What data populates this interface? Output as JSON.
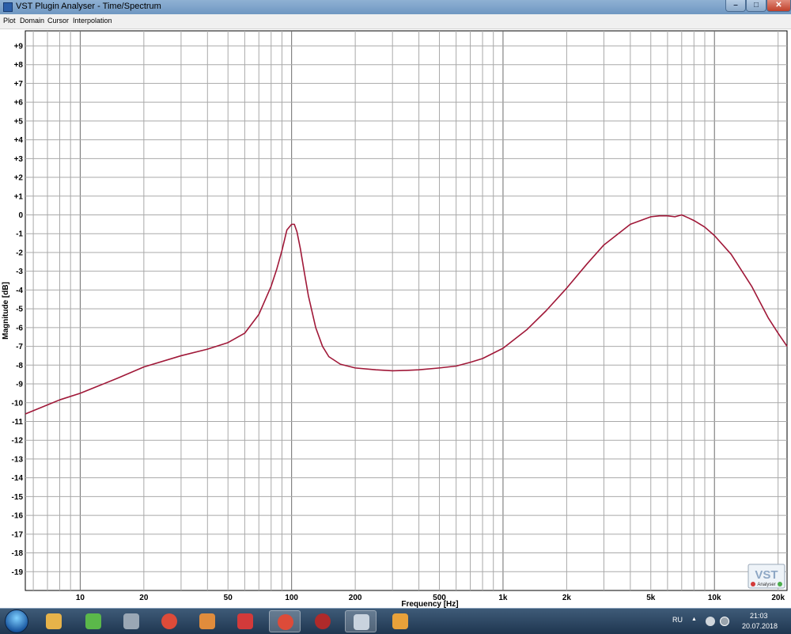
{
  "window": {
    "title": "VST Plugin Analyser - Time/Spectrum",
    "min_glyph": "–",
    "max_glyph": "□",
    "close_glyph": "✕"
  },
  "menu": [
    "Plot",
    "Domain",
    "Cursor",
    "Interpolation"
  ],
  "logo": {
    "text": "VST",
    "subtext": "Analyser"
  },
  "taskbar": {
    "language": "RU",
    "time": "21:03",
    "date": "20.07.2018",
    "tray_arrow": "▲",
    "apps": [
      {
        "name": "start-button",
        "icon": "windows-logo-icon"
      },
      {
        "name": "explorer",
        "icon": "folder-icon",
        "color": "#e7b34a"
      },
      {
        "name": "utorrent",
        "icon": "utorrent-icon",
        "color": "#5bb84a"
      },
      {
        "name": "calculator",
        "icon": "calculator-icon",
        "color": "#9aa7b5"
      },
      {
        "name": "chrome",
        "icon": "chrome-icon",
        "color": "#dd4b39"
      },
      {
        "name": "paint",
        "icon": "palette-icon",
        "color": "#e08c3c"
      },
      {
        "name": "daw",
        "icon": "fl-studio-icon",
        "color": "#d33a3a"
      },
      {
        "name": "chrome-2",
        "icon": "chrome-icon",
        "color": "#dd4b39"
      },
      {
        "name": "player",
        "icon": "player-icon",
        "color": "#b02a2a"
      },
      {
        "name": "vst-analyser",
        "icon": "vst-analyser-icon",
        "color": "#c9d3de"
      },
      {
        "name": "media",
        "icon": "media-icon",
        "color": "#e8a13a"
      }
    ]
  },
  "chart_data": {
    "type": "line",
    "xlabel": "Frequency [Hz]",
    "ylabel": "Magnitude [dB]",
    "x_scale": "log",
    "xlim": [
      5.5,
      22050
    ],
    "ylim": [
      -20,
      9.8
    ],
    "grid": true,
    "x_tick_labels": [
      {
        "value": 10,
        "label": "10"
      },
      {
        "value": 20,
        "label": "20"
      },
      {
        "value": 50,
        "label": "50"
      },
      {
        "value": 100,
        "label": "100"
      },
      {
        "value": 200,
        "label": "200"
      },
      {
        "value": 500,
        "label": "500"
      },
      {
        "value": 1000,
        "label": "1k"
      },
      {
        "value": 2000,
        "label": "2k"
      },
      {
        "value": 5000,
        "label": "5k"
      },
      {
        "value": 10000,
        "label": "10k"
      },
      {
        "value": 20000,
        "label": "20k"
      }
    ],
    "y_tick_labels": [
      {
        "value": 9,
        "label": "+9"
      },
      {
        "value": 8,
        "label": "+8"
      },
      {
        "value": 7,
        "label": "+7"
      },
      {
        "value": 6,
        "label": "+6"
      },
      {
        "value": 5,
        "label": "+5"
      },
      {
        "value": 4,
        "label": "+4"
      },
      {
        "value": 3,
        "label": "+3"
      },
      {
        "value": 2,
        "label": "+2"
      },
      {
        "value": 1,
        "label": "+1"
      },
      {
        "value": 0,
        "label": "0"
      },
      {
        "value": -1,
        "label": "-1"
      },
      {
        "value": -2,
        "label": "-2"
      },
      {
        "value": -3,
        "label": "-3"
      },
      {
        "value": -4,
        "label": "-4"
      },
      {
        "value": -5,
        "label": "-5"
      },
      {
        "value": -6,
        "label": "-6"
      },
      {
        "value": -7,
        "label": "-7"
      },
      {
        "value": -8,
        "label": "-8"
      },
      {
        "value": -9,
        "label": "-9"
      },
      {
        "value": -10,
        "label": "-10"
      },
      {
        "value": -11,
        "label": "-11"
      },
      {
        "value": -12,
        "label": "-12"
      },
      {
        "value": -13,
        "label": "-13"
      },
      {
        "value": -14,
        "label": "-14"
      },
      {
        "value": -15,
        "label": "-15"
      },
      {
        "value": -16,
        "label": "-16"
      },
      {
        "value": -17,
        "label": "-17"
      },
      {
        "value": -18,
        "label": "-18"
      },
      {
        "value": -19,
        "label": "-19"
      }
    ],
    "series": [
      {
        "color": "#a01838",
        "x": [
          5.5,
          8,
          10,
          15,
          20,
          30,
          40,
          50,
          60,
          70,
          80,
          85,
          90,
          95,
          100,
          103,
          106,
          110,
          115,
          120,
          130,
          140,
          150,
          170,
          200,
          250,
          300,
          350,
          400,
          500,
          600,
          700,
          800,
          1000,
          1300,
          1600,
          2000,
          2500,
          3000,
          4000,
          5000,
          5500,
          6000,
          6500,
          7000,
          7500,
          8000,
          9000,
          10000,
          12000,
          15000,
          18000,
          20000,
          22050
        ],
        "y": [
          -10.6,
          -9.85,
          -9.5,
          -8.7,
          -8.1,
          -7.5,
          -7.15,
          -6.8,
          -6.3,
          -5.3,
          -3.8,
          -2.9,
          -1.9,
          -0.8,
          -0.5,
          -0.5,
          -0.9,
          -1.8,
          -3.1,
          -4.3,
          -6.0,
          -7.0,
          -7.55,
          -7.95,
          -8.15,
          -8.25,
          -8.3,
          -8.28,
          -8.25,
          -8.15,
          -8.05,
          -7.85,
          -7.65,
          -7.1,
          -6.1,
          -5.1,
          -3.9,
          -2.6,
          -1.6,
          -0.5,
          -0.1,
          -0.05,
          -0.05,
          -0.1,
          0.0,
          -0.15,
          -0.3,
          -0.65,
          -1.1,
          -2.1,
          -3.8,
          -5.5,
          -6.3,
          -7.0
        ]
      }
    ]
  }
}
